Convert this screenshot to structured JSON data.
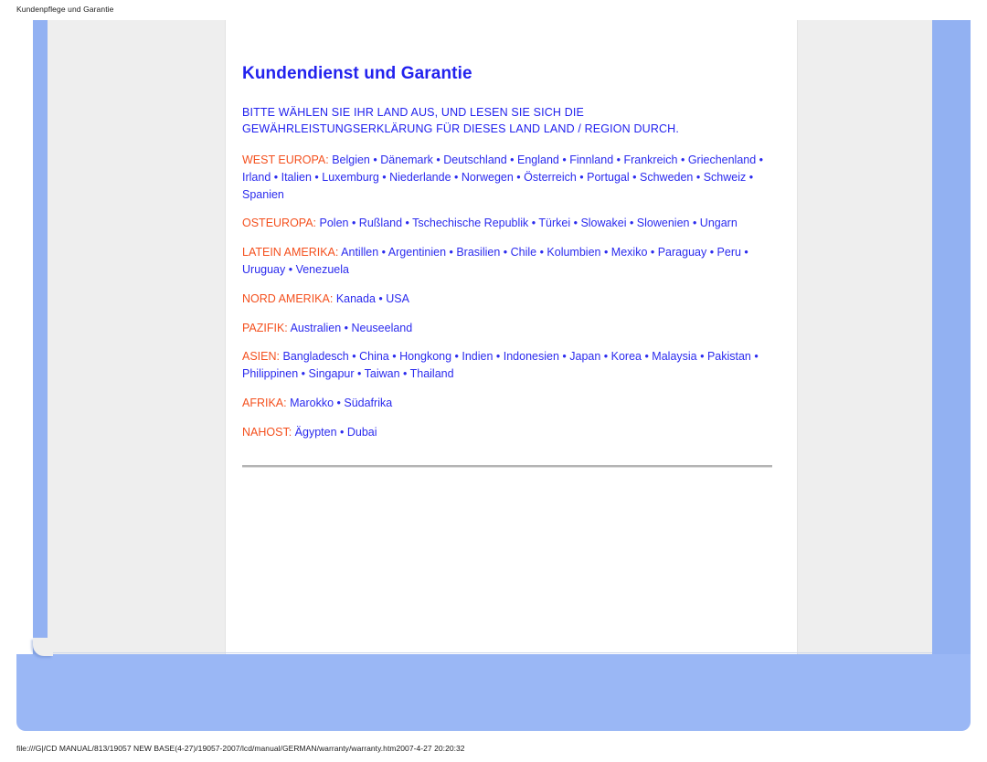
{
  "print_header": {
    "breadcrumb": "Kundenpflege und Garantie"
  },
  "document": {
    "title": "Kundendienst und Garantie",
    "lead_line_1": "BITTE WÄHLEN SIE IHR LAND AUS, UND LESEN SIE SICH DIE",
    "lead_line_2": "GEWÄHRLEISTUNGSERKLÄRUNG FÜR DIESES LAND LAND / REGION DURCH.",
    "regions": [
      {
        "label": "WEST EUROPA:",
        "countries": "Belgien • Dänemark • Deutschland • England • Finnland • Frankreich • Griechenland • Irland • Italien • Luxemburg • Niederlande • Norwegen • Österreich • Portugal • Schweden • Schweiz • Spanien"
      },
      {
        "label": "OSTEUROPA:",
        "countries": "Polen • Rußland • Tschechische Republik • Türkei • Slowakei • Slowenien • Ungarn"
      },
      {
        "label": "LATEIN AMERIKA:",
        "countries": "Antillen • Argentinien • Brasilien • Chile • Kolumbien • Mexiko • Paraguay • Peru • Uruguay • Venezuela"
      },
      {
        "label": "NORD AMERIKA:",
        "countries": "Kanada • USA"
      },
      {
        "label": "PAZIFIK:",
        "countries": "Australien • Neuseeland"
      },
      {
        "label": "ASIEN:",
        "countries": "Bangladesch • China • Hongkong • Indien • Indonesien • Japan • Korea • Malaysia • Pakistan • Philippinen • Singapur • Taiwan • Thailand"
      },
      {
        "label": "AFRIKA:",
        "countries": "Marokko • Südafrika"
      },
      {
        "label": "NAHOST:",
        "countries": "Ägypten • Dubai"
      }
    ]
  },
  "print_footer": {
    "path": "file:///G|/CD MANUAL/813/19057 NEW BASE(4-27)/19057-2007/lcd/manual/GERMAN/warranty/warranty.htm2007-4-27 20:20:32"
  },
  "colors": {
    "title_blue": "#2222ee",
    "body_blue": "#2b2bee",
    "region_orange": "#f4501e",
    "frame_blue": "#9ab7f5",
    "sheet_grey": "#eeeeee"
  }
}
